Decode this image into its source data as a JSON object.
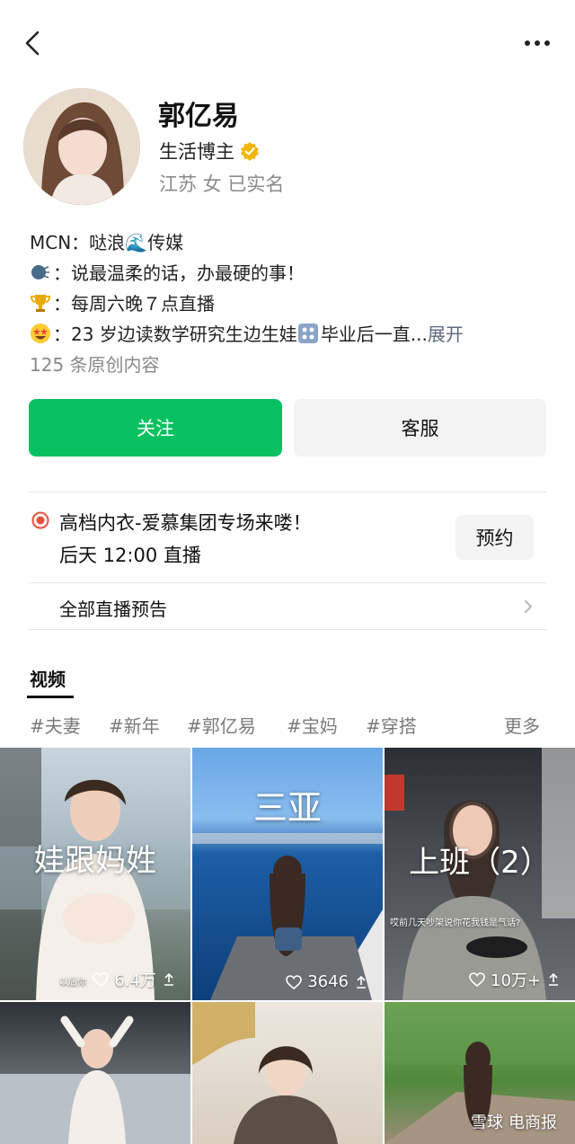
{
  "profile": {
    "name": "郭亿易",
    "role": "生活博主",
    "meta": "江苏 女 已实名",
    "bio": [
      {
        "icon": "wave-emoji",
        "text": "MCN：哒浪🌊传媒"
      },
      {
        "icon": "speaking-emoji",
        "text": "：说最温柔的话，办最硬的事！"
      },
      {
        "icon": "trophy-emoji",
        "text": "：每周六晚７点直播"
      },
      {
        "icon": "star-eyes-emoji",
        "text": "：23 岁边读数学研究生边生娃",
        "tail": "毕业后一直...",
        "expand": "展开"
      }
    ],
    "original_count": "125 条原创内容"
  },
  "actions": {
    "follow": "关注",
    "service": "客服"
  },
  "live": {
    "title": "高档内衣-爱慕集团专场来喽！",
    "time": "后天 12:00 直播",
    "reserve": "预约",
    "all_label": "全部直播预告"
  },
  "tabs": {
    "video": "视频"
  },
  "tags": [
    "#夫妻",
    "#新年",
    "#郭亿易",
    "#宝妈",
    "#穿搭"
  ],
  "more_tags": "更多",
  "videos": [
    {
      "overlay": "娃跟妈姓",
      "likes": "6.4万",
      "caption": "以后你"
    },
    {
      "overlay": "三亚",
      "likes": "3646",
      "caption": ""
    },
    {
      "overlay": "上班（2）",
      "likes": "10万+",
      "caption": "哎前几天吵架说你花我钱是气话?"
    },
    {
      "overlay": "",
      "likes": "",
      "caption": ""
    },
    {
      "overlay": "",
      "likes": "",
      "caption": ""
    },
    {
      "overlay": "",
      "likes": "",
      "caption": ""
    }
  ],
  "watermark": {
    "logo": "雪球",
    "source": "电商报"
  },
  "colors": {
    "accent": "#07c160",
    "verify": "#f5b400",
    "live": "#e94e3c",
    "link": "#5e6a80"
  }
}
